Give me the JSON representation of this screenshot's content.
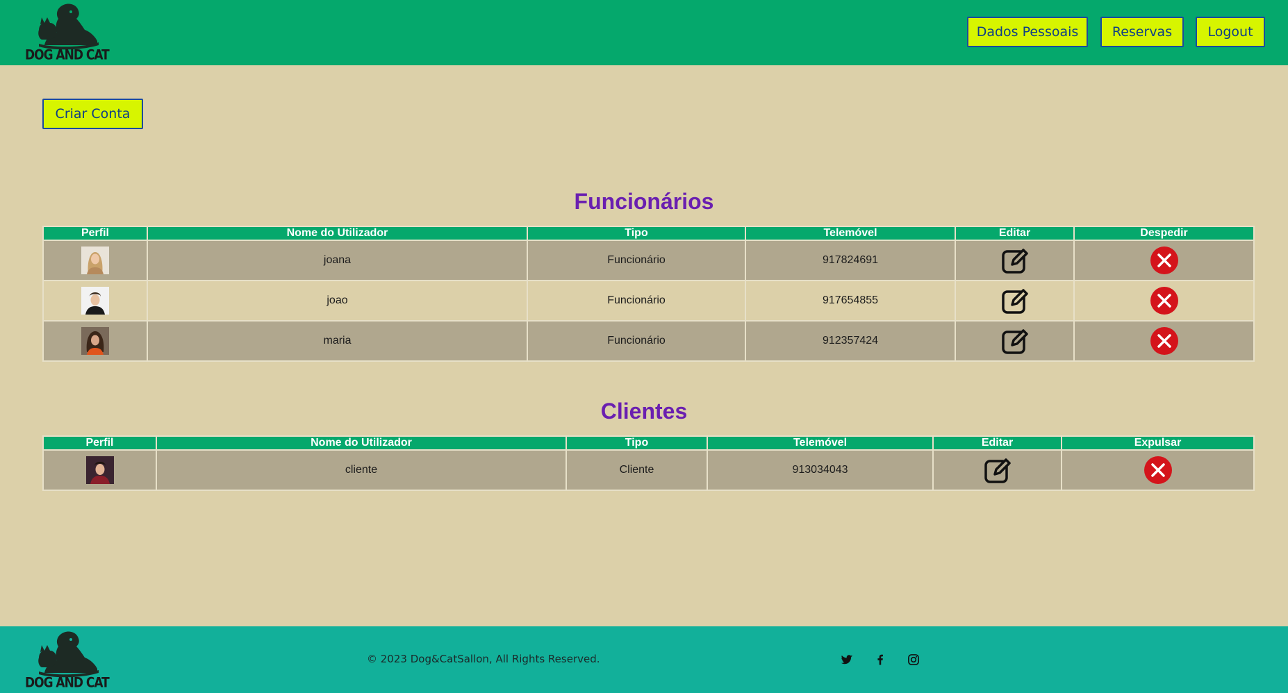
{
  "brand": {
    "logo_text": "DOG AND CAT"
  },
  "nav": {
    "dados_pessoais": "Dados Pessoais",
    "reservas": "Reservas",
    "logout": "Logout"
  },
  "actions": {
    "criar_conta": "Criar Conta"
  },
  "funcionarios": {
    "title": "Funcionários",
    "headers": {
      "perfil": "Perfil",
      "nome": "Nome do Utilizador",
      "tipo": "Tipo",
      "telemovel": "Telemóvel",
      "editar": "Editar",
      "remover": "Despedir"
    },
    "rows": [
      {
        "nome": "joana",
        "tipo": "Funcionário",
        "telemovel": "917824691"
      },
      {
        "nome": "joao",
        "tipo": "Funcionário",
        "telemovel": "917654855"
      },
      {
        "nome": "maria",
        "tipo": "Funcionário",
        "telemovel": "912357424"
      }
    ]
  },
  "clientes": {
    "title": "Clientes",
    "headers": {
      "perfil": "Perfil",
      "nome": "Nome do Utilizador",
      "tipo": "Tipo",
      "telemovel": "Telemóvel",
      "editar": "Editar",
      "remover": "Expulsar"
    },
    "rows": [
      {
        "nome": "cliente",
        "tipo": "Cliente",
        "telemovel": "913034043"
      }
    ]
  },
  "footer": {
    "copyright": "© 2023 Dog&CatSallon, All Rights Reserved.",
    "social_icons": [
      "twitter-icon",
      "facebook-icon",
      "instagram-icon"
    ]
  },
  "colors": {
    "header_bg": "#05a86c",
    "page_bg": "#dcd0a9",
    "footer_bg": "#12b09a",
    "button_bg": "#d7f500",
    "button_border": "#1b4b9c",
    "title_purple": "#6a1fb0",
    "table_header": "#05a86c",
    "row_dark": "#b0a78e",
    "remove_red": "#d4141b"
  }
}
